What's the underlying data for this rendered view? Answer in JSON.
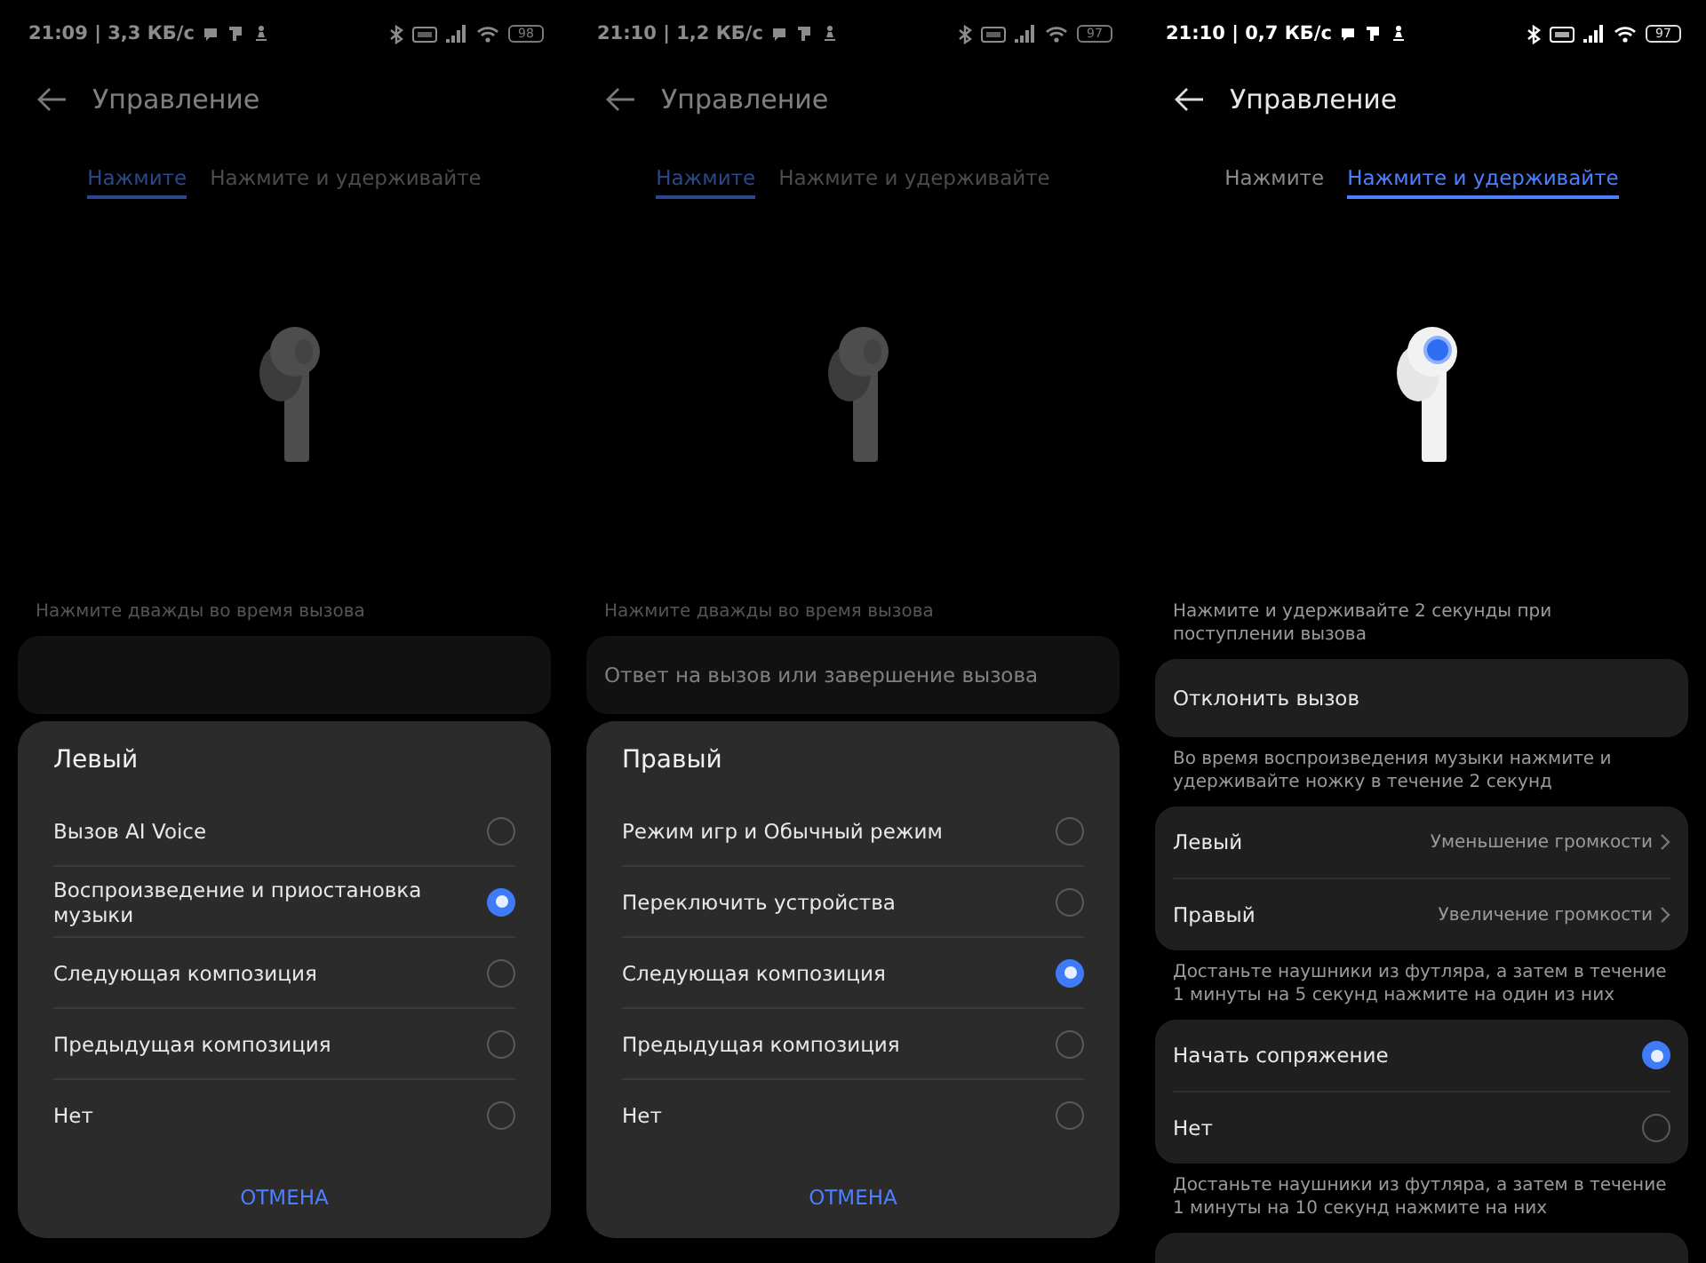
{
  "screens": [
    {
      "status_bar": {
        "time": "21:09 | 3,3 КБ/с",
        "battery": "98"
      },
      "header": {
        "title": "Управление"
      },
      "tabs": [
        {
          "label": "Нажмите",
          "selected": true
        },
        {
          "label": "Нажмите и удерживайте",
          "selected": false
        }
      ],
      "earbud": {
        "highlighted": false
      },
      "sections": [
        {
          "caption": "Нажмите дважды во время вызова"
        }
      ],
      "sheet": {
        "title": "Левый",
        "options": [
          {
            "label": "Вызов AI Voice",
            "selected": false
          },
          {
            "label": "Воспроизведение и приостановка музыки",
            "selected": true
          },
          {
            "label": "Следующая композиция",
            "selected": false
          },
          {
            "label": "Предыдущая композиция",
            "selected": false
          },
          {
            "label": "Нет",
            "selected": false
          }
        ],
        "cancel": "ОТМЕНА"
      }
    },
    {
      "status_bar": {
        "time": "21:10 | 1,2 КБ/с",
        "battery": "97"
      },
      "header": {
        "title": "Управление"
      },
      "tabs": [
        {
          "label": "Нажмите",
          "selected": true
        },
        {
          "label": "Нажмите и удерживайте",
          "selected": false
        }
      ],
      "earbud": {
        "highlighted": false
      },
      "sections": [
        {
          "caption": "Нажмите дважды во время вызова",
          "rows": [
            {
              "kind": "plain",
              "label": "Ответ на вызов или завершение вызова"
            }
          ]
        }
      ],
      "sheet": {
        "title": "Правый",
        "options": [
          {
            "label": "Режим игр и Обычный режим",
            "selected": false
          },
          {
            "label": "Переключить устройства",
            "selected": false
          },
          {
            "label": "Следующая композиция",
            "selected": true
          },
          {
            "label": "Предыдущая композиция",
            "selected": false
          },
          {
            "label": "Нет",
            "selected": false
          }
        ],
        "cancel": "ОТМЕНА"
      }
    },
    {
      "status_bar": {
        "time": "21:10 | 0,7 КБ/с",
        "battery": "97"
      },
      "header": {
        "title": "Управление"
      },
      "tabs": [
        {
          "label": "Нажмите",
          "selected": false
        },
        {
          "label": "Нажмите и удерживайте",
          "selected": true
        }
      ],
      "earbud": {
        "highlighted": true
      },
      "sections": [
        {
          "caption": "Нажмите и удерживайте 2 секунды при поступлении вызова",
          "rows": [
            {
              "kind": "plain",
              "label": "Отклонить вызов"
            }
          ]
        },
        {
          "caption": "Во время воспроизведения музыки нажмите и удерживайте ножку в течение 2 секунд",
          "rows": [
            {
              "kind": "value",
              "label": "Левый",
              "value": "Уменьшение громкости"
            },
            {
              "kind": "value",
              "label": "Правый",
              "value": "Увеличение громкости"
            }
          ]
        },
        {
          "caption": "Достаньте наушники из футляра, а затем в течение 1 минуты на 5 секунд нажмите на один из них",
          "rows": [
            {
              "kind": "radio",
              "label": "Начать сопряжение",
              "selected": true
            },
            {
              "kind": "radio",
              "label": "Нет",
              "selected": false
            }
          ]
        },
        {
          "caption": "Достаньте наушники из футляра, а затем в течение 1 минуты на 10 секунд нажмите на них"
        }
      ]
    }
  ]
}
